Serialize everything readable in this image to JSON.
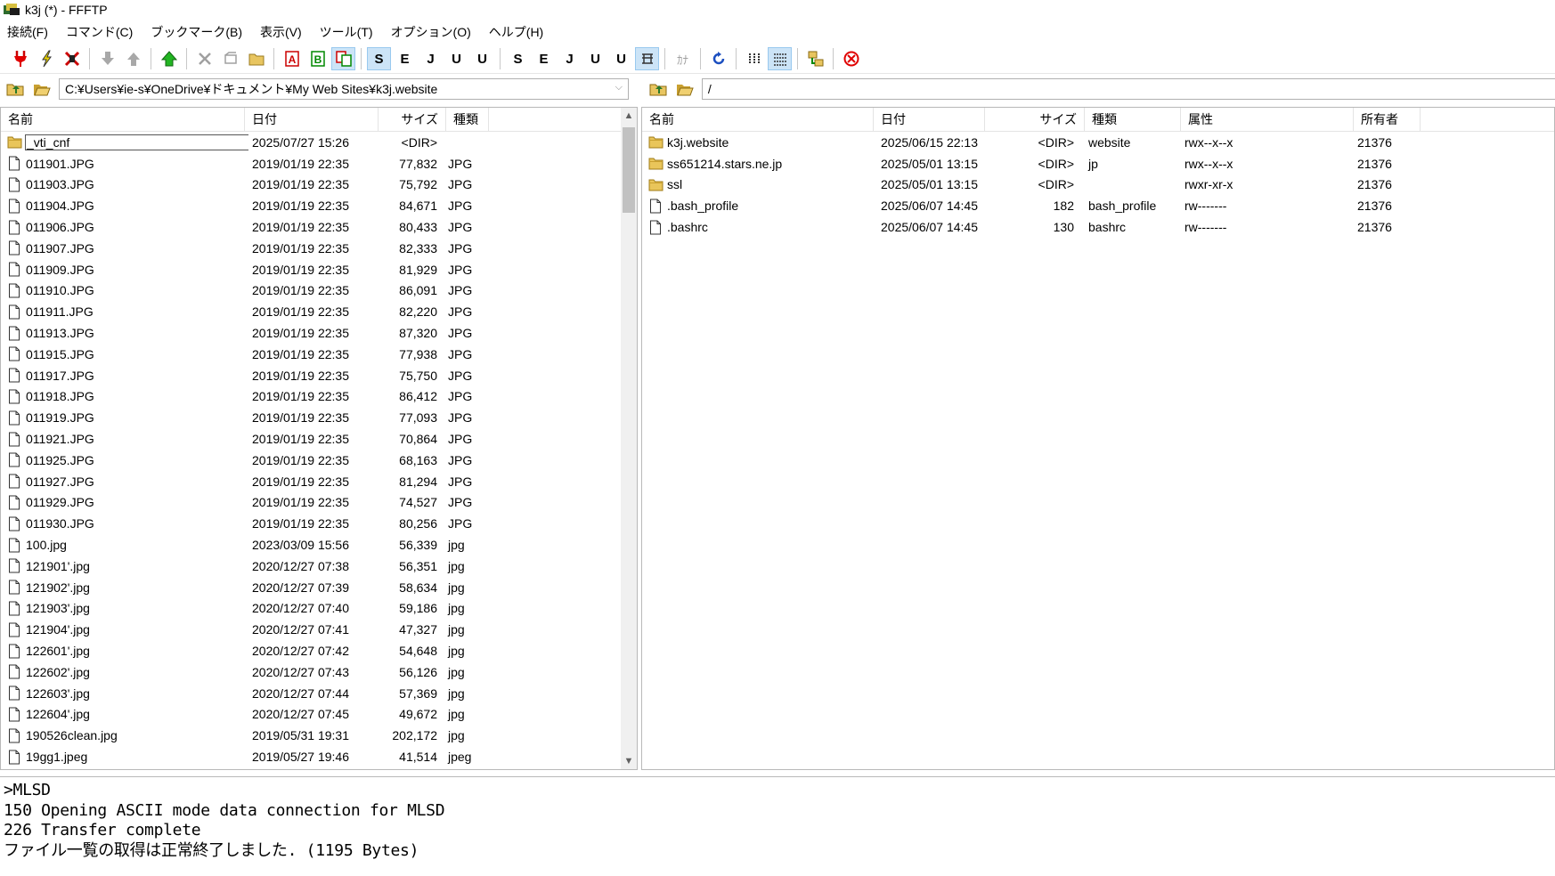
{
  "window": {
    "title": "k3j (*) - FFFTP"
  },
  "menubar": {
    "items": [
      "接続(F)",
      "コマンド(C)",
      "ブックマーク(B)",
      "表示(V)",
      "ツール(T)",
      "オプション(O)",
      "ヘルプ(H)"
    ]
  },
  "toolbar": {
    "text_buttons": {
      "sjis": "S",
      "euc": "E",
      "jis": "J",
      "utf8": "U",
      "utf8bom": "U",
      "sjis2": "S",
      "euc2": "E",
      "jis2": "J",
      "utf8n": "U",
      "utf8bom2": "U",
      "kana": "ｶﾅ"
    }
  },
  "left": {
    "path": "C:¥Users¥ie-s¥OneDrive¥ドキュメント¥My Web Sites¥k3j.website",
    "headers": {
      "name": "名前",
      "date": "日付",
      "size": "サイズ",
      "type": "種類"
    },
    "files": [
      {
        "name": "_vti_cnf",
        "date": "2025/07/27 15:26",
        "size": "<DIR>",
        "type": "",
        "dir": true
      },
      {
        "name": "011901.JPG",
        "date": "2019/01/19 22:35",
        "size": "77,832",
        "type": "JPG"
      },
      {
        "name": "011903.JPG",
        "date": "2019/01/19 22:35",
        "size": "75,792",
        "type": "JPG"
      },
      {
        "name": "011904.JPG",
        "date": "2019/01/19 22:35",
        "size": "84,671",
        "type": "JPG"
      },
      {
        "name": "011906.JPG",
        "date": "2019/01/19 22:35",
        "size": "80,433",
        "type": "JPG"
      },
      {
        "name": "011907.JPG",
        "date": "2019/01/19 22:35",
        "size": "82,333",
        "type": "JPG"
      },
      {
        "name": "011909.JPG",
        "date": "2019/01/19 22:35",
        "size": "81,929",
        "type": "JPG"
      },
      {
        "name": "011910.JPG",
        "date": "2019/01/19 22:35",
        "size": "86,091",
        "type": "JPG"
      },
      {
        "name": "011911.JPG",
        "date": "2019/01/19 22:35",
        "size": "82,220",
        "type": "JPG"
      },
      {
        "name": "011913.JPG",
        "date": "2019/01/19 22:35",
        "size": "87,320",
        "type": "JPG"
      },
      {
        "name": "011915.JPG",
        "date": "2019/01/19 22:35",
        "size": "77,938",
        "type": "JPG"
      },
      {
        "name": "011917.JPG",
        "date": "2019/01/19 22:35",
        "size": "75,750",
        "type": "JPG"
      },
      {
        "name": "011918.JPG",
        "date": "2019/01/19 22:35",
        "size": "86,412",
        "type": "JPG"
      },
      {
        "name": "011919.JPG",
        "date": "2019/01/19 22:35",
        "size": "77,093",
        "type": "JPG"
      },
      {
        "name": "011921.JPG",
        "date": "2019/01/19 22:35",
        "size": "70,864",
        "type": "JPG"
      },
      {
        "name": "011925.JPG",
        "date": "2019/01/19 22:35",
        "size": "68,163",
        "type": "JPG"
      },
      {
        "name": "011927.JPG",
        "date": "2019/01/19 22:35",
        "size": "81,294",
        "type": "JPG"
      },
      {
        "name": "011929.JPG",
        "date": "2019/01/19 22:35",
        "size": "74,527",
        "type": "JPG"
      },
      {
        "name": "011930.JPG",
        "date": "2019/01/19 22:35",
        "size": "80,256",
        "type": "JPG"
      },
      {
        "name": "100.jpg",
        "date": "2023/03/09 15:56",
        "size": "56,339",
        "type": "jpg"
      },
      {
        "name": "121901'.jpg",
        "date": "2020/12/27 07:38",
        "size": "56,351",
        "type": "jpg"
      },
      {
        "name": "121902'.jpg",
        "date": "2020/12/27 07:39",
        "size": "58,634",
        "type": "jpg"
      },
      {
        "name": "121903'.jpg",
        "date": "2020/12/27 07:40",
        "size": "59,186",
        "type": "jpg"
      },
      {
        "name": "121904'.jpg",
        "date": "2020/12/27 07:41",
        "size": "47,327",
        "type": "jpg"
      },
      {
        "name": "122601'.jpg",
        "date": "2020/12/27 07:42",
        "size": "54,648",
        "type": "jpg"
      },
      {
        "name": "122602'.jpg",
        "date": "2020/12/27 07:43",
        "size": "56,126",
        "type": "jpg"
      },
      {
        "name": "122603'.jpg",
        "date": "2020/12/27 07:44",
        "size": "57,369",
        "type": "jpg"
      },
      {
        "name": "122604'.jpg",
        "date": "2020/12/27 07:45",
        "size": "49,672",
        "type": "jpg"
      },
      {
        "name": "190526clean.jpg",
        "date": "2019/05/31 19:31",
        "size": "202,172",
        "type": "jpg"
      },
      {
        "name": "19gg1.jpeg",
        "date": "2019/05/27 19:46",
        "size": "41,514",
        "type": "jpeg"
      }
    ]
  },
  "right": {
    "path": "/",
    "headers": {
      "name": "名前",
      "date": "日付",
      "size": "サイズ",
      "type": "種類",
      "attr": "属性",
      "owner": "所有者"
    },
    "files": [
      {
        "name": "k3j.website",
        "date": "2025/06/15 22:13",
        "size": "<DIR>",
        "type": "website",
        "attr": "rwx--x--x",
        "owner": "21376",
        "dir": true
      },
      {
        "name": "ss651214.stars.ne.jp",
        "date": "2025/05/01 13:15",
        "size": "<DIR>",
        "type": "jp",
        "attr": "rwx--x--x",
        "owner": "21376",
        "dir": true
      },
      {
        "name": "ssl",
        "date": "2025/05/01 13:15",
        "size": "<DIR>",
        "type": "",
        "attr": "rwxr-xr-x",
        "owner": "21376",
        "dir": true
      },
      {
        "name": ".bash_profile",
        "date": "2025/06/07 14:45",
        "size": "182",
        "type": "bash_profile",
        "attr": "rw-------",
        "owner": "21376"
      },
      {
        "name": ".bashrc",
        "date": "2025/06/07 14:45",
        "size": "130",
        "type": "bashrc",
        "attr": "rw-------",
        "owner": "21376"
      }
    ]
  },
  "log": {
    "lines": [
      ">MLSD",
      "150 Opening ASCII mode data connection for MLSD",
      "226 Transfer complete",
      "ファイル一覧の取得は正常終了しました. (1195 Bytes)"
    ]
  }
}
